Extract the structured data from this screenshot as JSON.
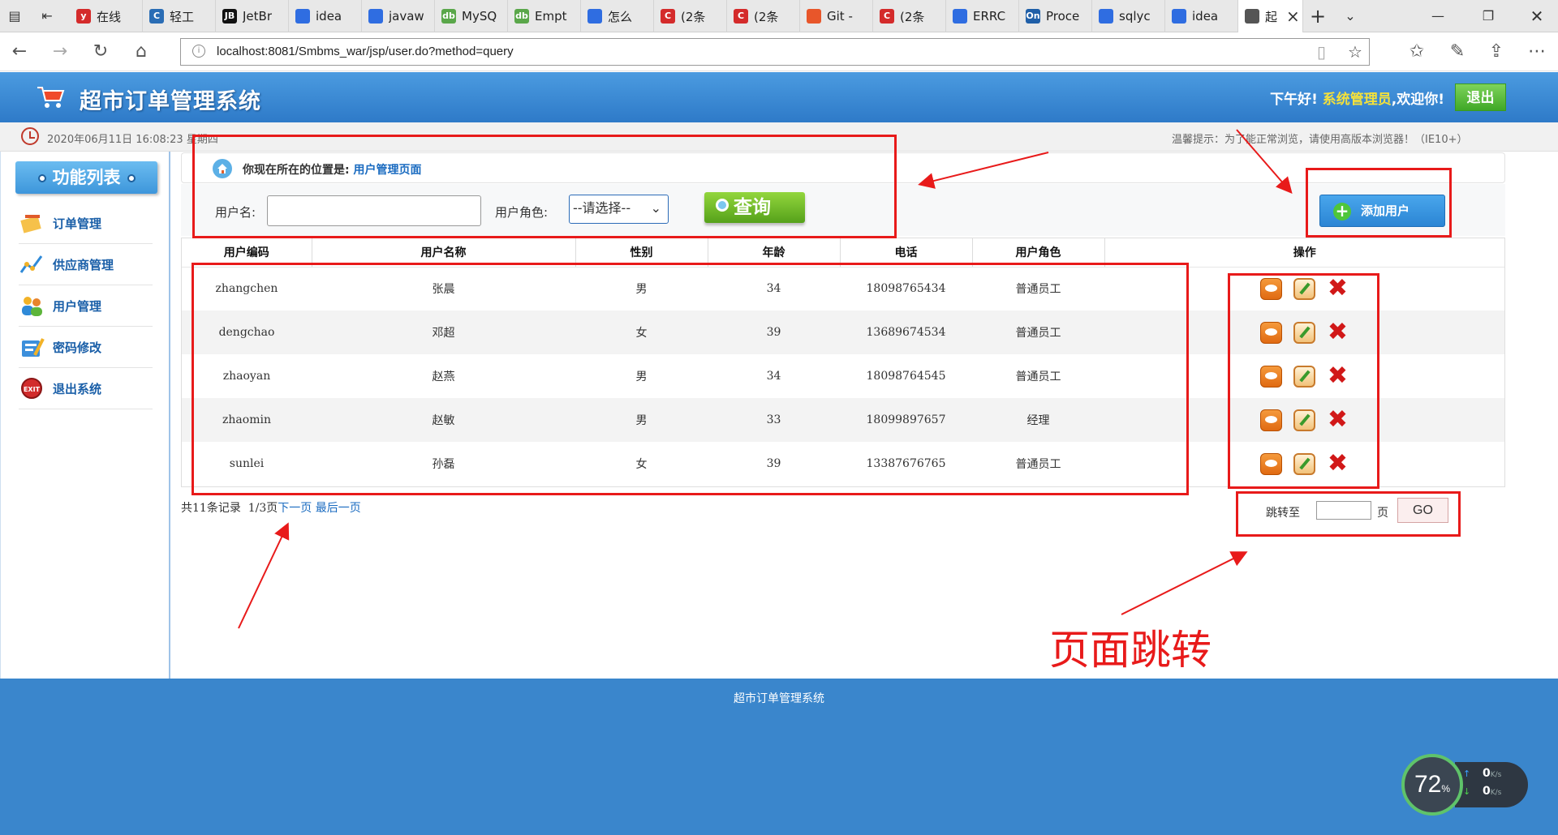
{
  "browser": {
    "tabs": [
      {
        "title": "",
        "icon": "tab-list-icon",
        "color": "#555555"
      },
      {
        "title": "",
        "icon": "back-tab-icon",
        "color": "#555555"
      },
      {
        "title": "在线",
        "icon": "y",
        "color": "#d42b2b"
      },
      {
        "title": "轻工",
        "icon": "C",
        "color": "#2a6db5"
      },
      {
        "title": "JetBr",
        "icon": "JB",
        "color": "#111111"
      },
      {
        "title": "idea",
        "icon": "paw",
        "color": "#2f6de1"
      },
      {
        "title": "javaw",
        "icon": "paw",
        "color": "#2f6de1"
      },
      {
        "title": "MySQ",
        "icon": "db",
        "color": "#5aa74a"
      },
      {
        "title": "Empt",
        "icon": "db",
        "color": "#5aa74a"
      },
      {
        "title": "怎么",
        "icon": "paw",
        "color": "#2f6de1"
      },
      {
        "title": "(2条",
        "icon": "C",
        "color": "#d42b2b"
      },
      {
        "title": "(2条",
        "icon": "C",
        "color": "#d42b2b"
      },
      {
        "title": "Git -",
        "icon": "git",
        "color": "#e8562a"
      },
      {
        "title": "(2条",
        "icon": "C",
        "color": "#d42b2b"
      },
      {
        "title": "ERRC",
        "icon": "paw",
        "color": "#2f6de1"
      },
      {
        "title": "Proce",
        "icon": "On",
        "color": "#1f5fa8"
      },
      {
        "title": "sqlyc",
        "icon": "paw",
        "color": "#2f6de1"
      },
      {
        "title": "idea",
        "icon": "paw",
        "color": "#2f6de1"
      },
      {
        "title": "起",
        "icon": "page",
        "color": "#555555"
      }
    ],
    "url": "localhost:8081/Smbms_war/jsp/user.do?method=query"
  },
  "header": {
    "app_title": "超市订单管理系统",
    "greeting_prefix": "下午好!",
    "admin_name": "系统管理员",
    "greeting_suffix": ",欢迎你!",
    "logout_label": "退出"
  },
  "info_bar": {
    "datetime": "2020年06月11日 16:08:23 星期四",
    "tip": "温馨提示：为了能正常浏览，请使用高版本浏览器！（IE10+）"
  },
  "sidebar": {
    "title": "功能列表",
    "items": [
      {
        "label": "订单管理",
        "icon": "order-icon"
      },
      {
        "label": "供应商管理",
        "icon": "provider-icon"
      },
      {
        "label": "用户管理",
        "icon": "users-icon"
      },
      {
        "label": "密码修改",
        "icon": "password-icon"
      },
      {
        "label": "退出系统",
        "icon": "exit-icon"
      }
    ]
  },
  "location": {
    "prefix": "你现在所在的位置是:",
    "current": "用户管理页面"
  },
  "search": {
    "username_label": "用户名:",
    "username_value": "",
    "role_label": "用户角色:",
    "role_selected": "--请选择--",
    "query_label": "查询",
    "add_user_label": "添加用户"
  },
  "table": {
    "columns": [
      "用户编码",
      "用户名称",
      "性别",
      "年龄",
      "电话",
      "用户角色",
      "操作"
    ],
    "rows": [
      {
        "code": "zhangchen",
        "name": "张晨",
        "gender": "男",
        "age": "34",
        "phone": "18098765434",
        "role": "普通员工"
      },
      {
        "code": "dengchao",
        "name": "邓超",
        "gender": "女",
        "age": "39",
        "phone": "13689674534",
        "role": "普通员工"
      },
      {
        "code": "zhaoyan",
        "name": "赵燕",
        "gender": "男",
        "age": "34",
        "phone": "18098764545",
        "role": "普通员工"
      },
      {
        "code": "zhaomin",
        "name": "赵敏",
        "gender": "男",
        "age": "33",
        "phone": "18099897657",
        "role": "经理"
      },
      {
        "code": "sunlei",
        "name": "孙磊",
        "gender": "女",
        "age": "39",
        "phone": "13387676765",
        "role": "普通员工"
      }
    ]
  },
  "pager": {
    "total": "共11条记录",
    "page": "1/3页",
    "next": "下一页",
    "last": "最后一页",
    "jump_label": "跳转至",
    "jump_value": "",
    "page_unit": "页",
    "go_label": "GO"
  },
  "footer": {
    "text": "超市订单管理系统",
    "speed_percent": "72",
    "speed_unit": "%",
    "upload": "0",
    "download": "0",
    "rate_unit": "K/s"
  },
  "annotation": {
    "caption": "页面跳转",
    "color": "#e81a1a"
  }
}
